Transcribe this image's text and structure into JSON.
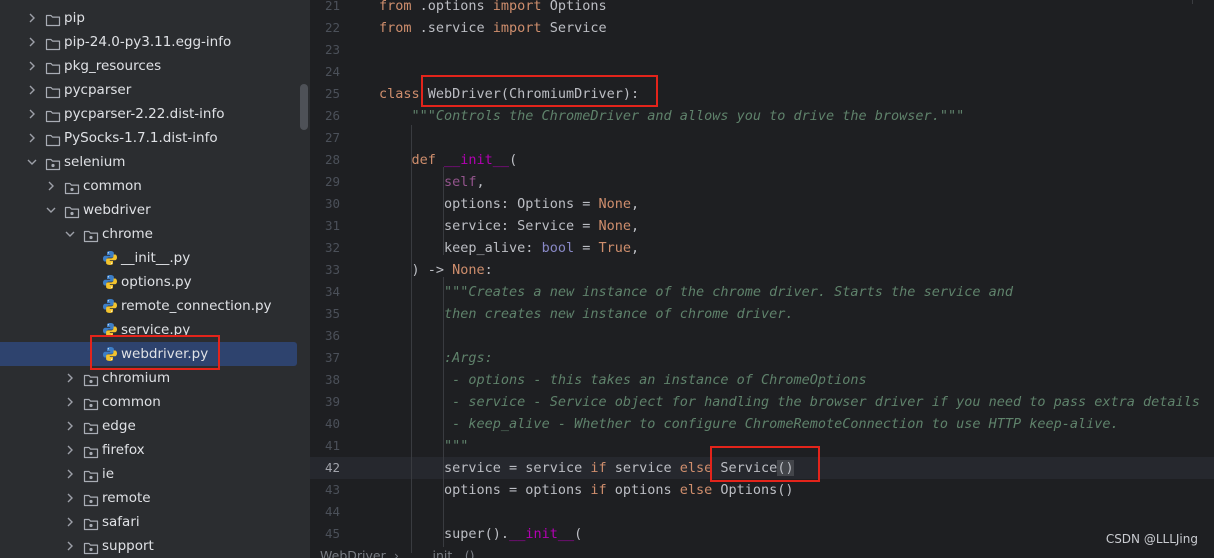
{
  "project_tree": {
    "items": [
      {
        "label": "pip",
        "type": "folder",
        "depth": 1,
        "expanded": false
      },
      {
        "label": "pip-24.0-py3.11.egg-info",
        "type": "folder",
        "depth": 1,
        "expanded": false
      },
      {
        "label": "pkg_resources",
        "type": "folder",
        "depth": 1,
        "expanded": false
      },
      {
        "label": "pycparser",
        "type": "folder",
        "depth": 1,
        "expanded": false
      },
      {
        "label": "pycparser-2.22.dist-info",
        "type": "folder",
        "depth": 1,
        "expanded": false
      },
      {
        "label": "PySocks-1.7.1.dist-info",
        "type": "folder",
        "depth": 1,
        "expanded": false
      },
      {
        "label": "selenium",
        "type": "package",
        "depth": 1,
        "expanded": true
      },
      {
        "label": "common",
        "type": "package",
        "depth": 2,
        "expanded": false
      },
      {
        "label": "webdriver",
        "type": "package",
        "depth": 2,
        "expanded": true
      },
      {
        "label": "chrome",
        "type": "package",
        "depth": 3,
        "expanded": true
      },
      {
        "label": "__init__.py",
        "type": "python",
        "depth": 4
      },
      {
        "label": "options.py",
        "type": "python",
        "depth": 4
      },
      {
        "label": "remote_connection.py",
        "type": "python",
        "depth": 4
      },
      {
        "label": "service.py",
        "type": "python",
        "depth": 4
      },
      {
        "label": "webdriver.py",
        "type": "python",
        "depth": 4,
        "selected": true
      },
      {
        "label": "chromium",
        "type": "package",
        "depth": 3,
        "expanded": false
      },
      {
        "label": "common",
        "type": "package",
        "depth": 3,
        "expanded": false
      },
      {
        "label": "edge",
        "type": "package",
        "depth": 3,
        "expanded": false
      },
      {
        "label": "firefox",
        "type": "package",
        "depth": 3,
        "expanded": false
      },
      {
        "label": "ie",
        "type": "package",
        "depth": 3,
        "expanded": false
      },
      {
        "label": "remote",
        "type": "package",
        "depth": 3,
        "expanded": false
      },
      {
        "label": "safari",
        "type": "package",
        "depth": 3,
        "expanded": false
      },
      {
        "label": "support",
        "type": "package",
        "depth": 3,
        "expanded": false
      }
    ]
  },
  "editor": {
    "current_line": "42",
    "lines": [
      {
        "num": "21",
        "indent": 0,
        "segments": [
          [
            "kw",
            "from"
          ],
          [
            "t",
            " .options "
          ],
          [
            "kw",
            "import"
          ],
          [
            "t",
            " Options"
          ]
        ]
      },
      {
        "num": "22",
        "indent": 0,
        "segments": [
          [
            "kw",
            "from"
          ],
          [
            "t",
            " .service "
          ],
          [
            "kw",
            "import"
          ],
          [
            "t",
            " Service"
          ]
        ]
      },
      {
        "num": "23",
        "indent": 0,
        "segments": []
      },
      {
        "num": "24",
        "indent": 0,
        "segments": []
      },
      {
        "num": "25",
        "indent": 0,
        "segments": [
          [
            "kw",
            "class "
          ],
          [
            "t",
            "WebDriver(ChromiumDriver):"
          ]
        ]
      },
      {
        "num": "26",
        "indent": 1,
        "segments": [
          [
            "doc",
            "\"\"\"Controls the ChromeDriver and allows you to drive the browser.\"\"\""
          ]
        ]
      },
      {
        "num": "27",
        "indent": 0,
        "segments": []
      },
      {
        "num": "28",
        "indent": 1,
        "segments": [
          [
            "kw",
            "def "
          ],
          [
            "magic",
            "__init__"
          ],
          [
            "t",
            "("
          ]
        ]
      },
      {
        "num": "29",
        "indent": 2,
        "segments": [
          [
            "self",
            "self"
          ],
          [
            "t",
            ","
          ]
        ]
      },
      {
        "num": "30",
        "indent": 2,
        "segments": [
          [
            "t",
            "options: Options = "
          ],
          [
            "kw",
            "None"
          ],
          [
            "t",
            ","
          ]
        ]
      },
      {
        "num": "31",
        "indent": 2,
        "segments": [
          [
            "t",
            "service: Service = "
          ],
          [
            "kw",
            "None"
          ],
          [
            "t",
            ","
          ]
        ]
      },
      {
        "num": "32",
        "indent": 2,
        "segments": [
          [
            "t",
            "keep_alive: "
          ],
          [
            "bi",
            "bool"
          ],
          [
            "t",
            " = "
          ],
          [
            "kw",
            "True"
          ],
          [
            "t",
            ","
          ]
        ]
      },
      {
        "num": "33",
        "indent": 1,
        "segments": [
          [
            "t",
            ") -> "
          ],
          [
            "kw",
            "None"
          ],
          [
            "t",
            ":"
          ]
        ]
      },
      {
        "num": "34",
        "indent": 2,
        "segments": [
          [
            "doc",
            "\"\"\"Creates a new instance of the chrome driver. Starts the service and"
          ]
        ]
      },
      {
        "num": "35",
        "indent": 2,
        "segments": [
          [
            "doc",
            "then creates new instance of chrome driver."
          ]
        ]
      },
      {
        "num": "36",
        "indent": 0,
        "segments": []
      },
      {
        "num": "37",
        "indent": 2,
        "segments": [
          [
            "doc",
            ":Args:"
          ]
        ]
      },
      {
        "num": "38",
        "indent": 2,
        "segments": [
          [
            "doc",
            " - options - this takes an instance of ChromeOptions"
          ]
        ]
      },
      {
        "num": "39",
        "indent": 2,
        "segments": [
          [
            "doc",
            " - service - Service object for handling the browser driver if you need to pass extra details"
          ]
        ]
      },
      {
        "num": "40",
        "indent": 2,
        "segments": [
          [
            "doc",
            " - keep_alive - Whether to configure ChromeRemoteConnection to use HTTP keep-alive."
          ]
        ]
      },
      {
        "num": "41",
        "indent": 2,
        "segments": [
          [
            "doc",
            "\"\"\""
          ]
        ]
      },
      {
        "num": "42",
        "indent": 2,
        "segments": [
          [
            "t",
            "service = service "
          ],
          [
            "kw",
            "if"
          ],
          [
            "t",
            " service "
          ],
          [
            "kw",
            "else"
          ],
          [
            "t",
            " Service"
          ],
          [
            "hl",
            "()"
          ]
        ]
      },
      {
        "num": "43",
        "indent": 2,
        "segments": [
          [
            "t",
            "options = options "
          ],
          [
            "kw",
            "if"
          ],
          [
            "t",
            " options "
          ],
          [
            "kw",
            "else"
          ],
          [
            "t",
            " Options()"
          ]
        ]
      },
      {
        "num": "44",
        "indent": 0,
        "segments": []
      },
      {
        "num": "45",
        "indent": 2,
        "segments": [
          [
            "t",
            "super()."
          ],
          [
            "magic",
            "__init__"
          ],
          [
            "t",
            "("
          ]
        ]
      }
    ]
  },
  "breadcrumb": [
    "WebDriver",
    "__init__()"
  ],
  "watermark": "CSDN @LLLJing",
  "colors": {
    "tree_bg": "#2b2d30",
    "editor_bg": "#1e1f22",
    "selection": "#2e436e",
    "keyword": "#cf8e6d",
    "docstring": "#5f826b",
    "annotation_box": "#e3241b"
  }
}
